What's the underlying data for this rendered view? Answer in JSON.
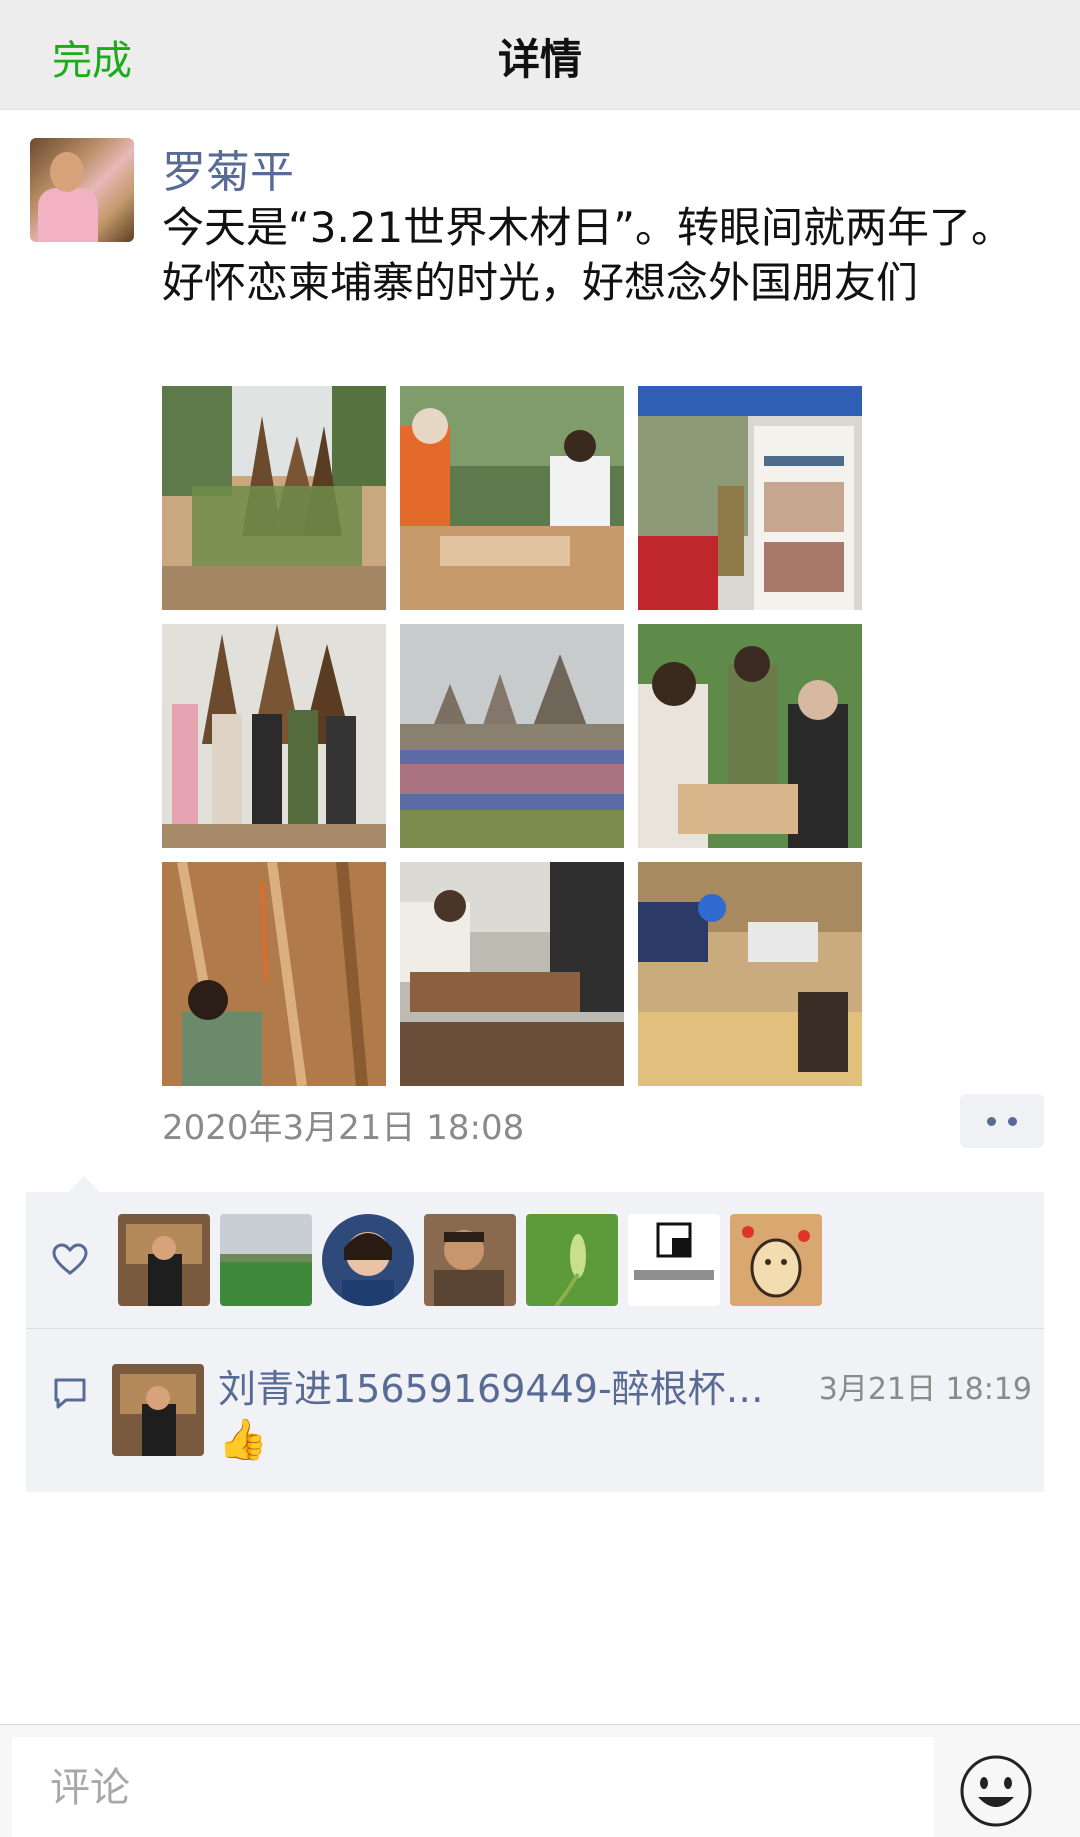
{
  "nav": {
    "done_label": "完成",
    "title": "详情"
  },
  "post": {
    "user_name": "罗菊平",
    "text": "今天是“3.21世界木材日”。转眼间就两年了。好怀恋柬埔寨的时光，好想念外国朋友们",
    "timestamp": "2020年3月21日 18:08",
    "photos": [
      "group-with-wooden-sculpture",
      "woodcarving-workshop",
      "exhibition-poster-booth",
      "group-photo-sculpture",
      "angkor-temple-crowd",
      "carving-session",
      "wooden-panel-installation",
      "sawing-wood",
      "team-assembling-structure"
    ]
  },
  "likes": {
    "icon": "heart-icon",
    "avatars": [
      "trophy-shelf-man",
      "green-field",
      "smiling-woman",
      "craftsman",
      "green-sprout",
      "calligraphy-logo",
      "lucky-cat"
    ]
  },
  "comments": [
    {
      "icon": "comment-icon",
      "name": "刘青进15659169449-醉根杯…",
      "time": "3月21日 18:19",
      "body": "👍"
    }
  ],
  "bottom_bar": {
    "comment_placeholder": "评论",
    "emoji_icon": "smiley-face-icon"
  },
  "colors": {
    "accent_green": "#1aad19",
    "name_blue": "#576b95",
    "panel_bg": "#f1f2f6"
  }
}
